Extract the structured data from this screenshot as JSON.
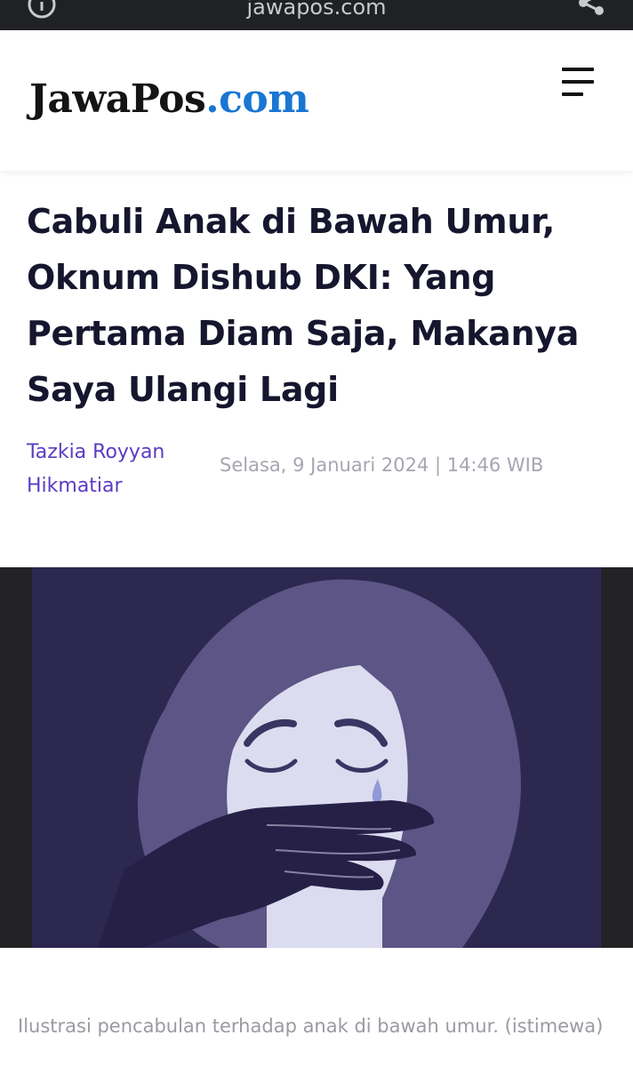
{
  "browser": {
    "url": "jawapos.com"
  },
  "site": {
    "logo_brand": "JawaPos",
    "logo_tld": ".com",
    "brand_color": "#141414",
    "accent_color": "#1976d2"
  },
  "article": {
    "title": "Cabuli Anak di Bawah Umur, Oknum Dishub DKI: Yang Pertama Diam Saja, Makanya Saya Ulangi Lagi",
    "author": "Tazkia Royyan Hikmatiar",
    "date": "Selasa, 9 Januari 2024 | 14:46 WIB",
    "image_caption": "Ilustrasi pencabulan terhadap anak di bawah umur. (istimewa)"
  },
  "icons": {
    "info": "info-icon",
    "share": "share-icon",
    "menu": "hamburger-menu-icon"
  }
}
